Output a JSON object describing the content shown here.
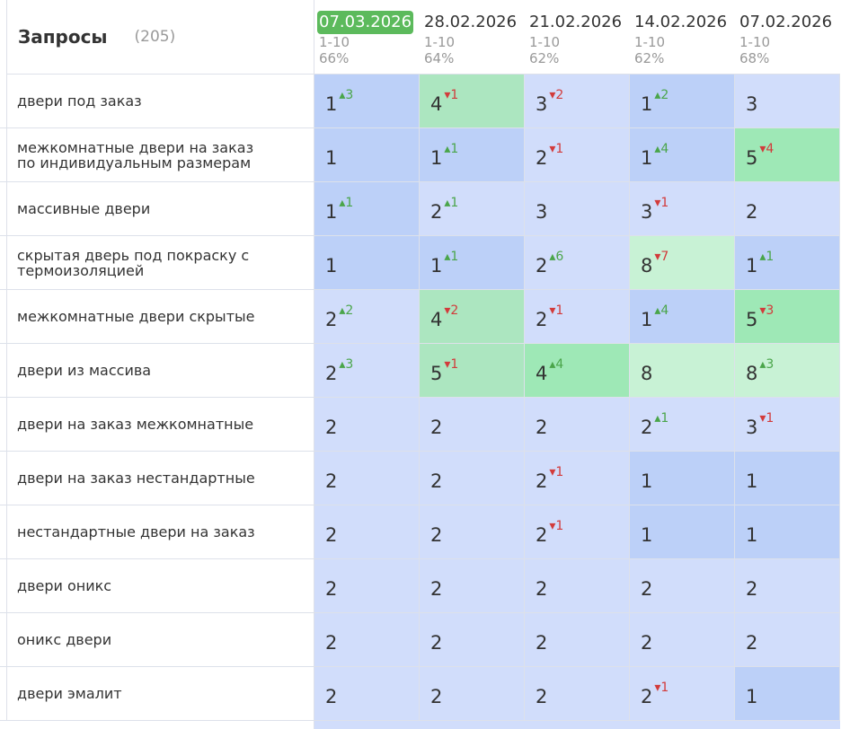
{
  "header": {
    "title": "Запросы",
    "count": "(205)"
  },
  "dates": [
    {
      "date": "07.03.2026",
      "range": "1-10",
      "percent": "66%",
      "active": true
    },
    {
      "date": "28.02.2026",
      "range": "1-10",
      "percent": "64%",
      "active": false
    },
    {
      "date": "21.02.2026",
      "range": "1-10",
      "percent": "62%",
      "active": false
    },
    {
      "date": "14.02.2026",
      "range": "1-10",
      "percent": "62%",
      "active": false
    },
    {
      "date": "07.02.2026",
      "range": "1-10",
      "percent": "68%",
      "active": false
    }
  ],
  "colors": {
    "top1": "#bcd0f8",
    "top3": "#d1ddfb",
    "top10": "#ace6c0",
    "up": "#4aa54a",
    "down": "#d23b3b",
    "active_date": "#5cba5c"
  },
  "rows": [
    {
      "query": "двери под заказ",
      "cells": [
        {
          "pos": "1",
          "chg": "3",
          "dir": "up",
          "bg": "top1"
        },
        {
          "pos": "4",
          "chg": "1",
          "dir": "down",
          "bg": "top10"
        },
        {
          "pos": "3",
          "chg": "2",
          "dir": "down",
          "bg": "top3"
        },
        {
          "pos": "1",
          "chg": "2",
          "dir": "up",
          "bg": "top1"
        },
        {
          "pos": "3",
          "chg": "",
          "dir": "",
          "bg": "top3"
        }
      ]
    },
    {
      "query": "межкомнатные двери на заказ по индивидуальным размерам",
      "cells": [
        {
          "pos": "1",
          "chg": "",
          "dir": "",
          "bg": "top1"
        },
        {
          "pos": "1",
          "chg": "1",
          "dir": "up",
          "bg": "top1"
        },
        {
          "pos": "2",
          "chg": "1",
          "dir": "down",
          "bg": "top3"
        },
        {
          "pos": "1",
          "chg": "4",
          "dir": "up",
          "bg": "top1"
        },
        {
          "pos": "5",
          "chg": "4",
          "dir": "down",
          "bg": "top10c"
        }
      ]
    },
    {
      "query": "массивные двери",
      "cells": [
        {
          "pos": "1",
          "chg": "1",
          "dir": "up",
          "bg": "top1"
        },
        {
          "pos": "2",
          "chg": "1",
          "dir": "up",
          "bg": "top3"
        },
        {
          "pos": "3",
          "chg": "",
          "dir": "",
          "bg": "top3"
        },
        {
          "pos": "3",
          "chg": "1",
          "dir": "down",
          "bg": "top3"
        },
        {
          "pos": "2",
          "chg": "",
          "dir": "",
          "bg": "top3"
        }
      ]
    },
    {
      "query": "скрытая дверь под покраску с термоизоляцией",
      "cells": [
        {
          "pos": "1",
          "chg": "",
          "dir": "",
          "bg": "top1"
        },
        {
          "pos": "1",
          "chg": "1",
          "dir": "up",
          "bg": "top1"
        },
        {
          "pos": "2",
          "chg": "6",
          "dir": "up",
          "bg": "top3"
        },
        {
          "pos": "8",
          "chg": "7",
          "dir": "down",
          "bg": "top10b"
        },
        {
          "pos": "1",
          "chg": "1",
          "dir": "up",
          "bg": "top1"
        }
      ]
    },
    {
      "query": "межкомнатные двери скрытые",
      "cells": [
        {
          "pos": "2",
          "chg": "2",
          "dir": "up",
          "bg": "top3"
        },
        {
          "pos": "4",
          "chg": "2",
          "dir": "down",
          "bg": "top10"
        },
        {
          "pos": "2",
          "chg": "1",
          "dir": "down",
          "bg": "top3"
        },
        {
          "pos": "1",
          "chg": "4",
          "dir": "up",
          "bg": "top1"
        },
        {
          "pos": "5",
          "chg": "3",
          "dir": "down",
          "bg": "top10c"
        }
      ]
    },
    {
      "query": "двери из массива",
      "cells": [
        {
          "pos": "2",
          "chg": "3",
          "dir": "up",
          "bg": "top3"
        },
        {
          "pos": "5",
          "chg": "1",
          "dir": "down",
          "bg": "top10"
        },
        {
          "pos": "4",
          "chg": "4",
          "dir": "up",
          "bg": "top10c"
        },
        {
          "pos": "8",
          "chg": "",
          "dir": "",
          "bg": "top10b"
        },
        {
          "pos": "8",
          "chg": "3",
          "dir": "up",
          "bg": "top10b"
        }
      ]
    },
    {
      "query": "двери на заказ межкомнатные",
      "cells": [
        {
          "pos": "2",
          "chg": "",
          "dir": "",
          "bg": "top3"
        },
        {
          "pos": "2",
          "chg": "",
          "dir": "",
          "bg": "top3"
        },
        {
          "pos": "2",
          "chg": "",
          "dir": "",
          "bg": "top3"
        },
        {
          "pos": "2",
          "chg": "1",
          "dir": "up",
          "bg": "top3"
        },
        {
          "pos": "3",
          "chg": "1",
          "dir": "down",
          "bg": "top3"
        }
      ]
    },
    {
      "query": "двери на заказ нестандартные",
      "cells": [
        {
          "pos": "2",
          "chg": "",
          "dir": "",
          "bg": "top3"
        },
        {
          "pos": "2",
          "chg": "",
          "dir": "",
          "bg": "top3"
        },
        {
          "pos": "2",
          "chg": "1",
          "dir": "down",
          "bg": "top3"
        },
        {
          "pos": "1",
          "chg": "",
          "dir": "",
          "bg": "top1"
        },
        {
          "pos": "1",
          "chg": "",
          "dir": "",
          "bg": "top1"
        }
      ]
    },
    {
      "query": "нестандартные двери на заказ",
      "cells": [
        {
          "pos": "2",
          "chg": "",
          "dir": "",
          "bg": "top3"
        },
        {
          "pos": "2",
          "chg": "",
          "dir": "",
          "bg": "top3"
        },
        {
          "pos": "2",
          "chg": "1",
          "dir": "down",
          "bg": "top3"
        },
        {
          "pos": "1",
          "chg": "",
          "dir": "",
          "bg": "top1"
        },
        {
          "pos": "1",
          "chg": "",
          "dir": "",
          "bg": "top1"
        }
      ]
    },
    {
      "query": "двери оникс",
      "cells": [
        {
          "pos": "2",
          "chg": "",
          "dir": "",
          "bg": "top3"
        },
        {
          "pos": "2",
          "chg": "",
          "dir": "",
          "bg": "top3"
        },
        {
          "pos": "2",
          "chg": "",
          "dir": "",
          "bg": "top3"
        },
        {
          "pos": "2",
          "chg": "",
          "dir": "",
          "bg": "top3"
        },
        {
          "pos": "2",
          "chg": "",
          "dir": "",
          "bg": "top3"
        }
      ]
    },
    {
      "query": "оникс двери",
      "cells": [
        {
          "pos": "2",
          "chg": "",
          "dir": "",
          "bg": "top3"
        },
        {
          "pos": "2",
          "chg": "",
          "dir": "",
          "bg": "top3"
        },
        {
          "pos": "2",
          "chg": "",
          "dir": "",
          "bg": "top3"
        },
        {
          "pos": "2",
          "chg": "",
          "dir": "",
          "bg": "top3"
        },
        {
          "pos": "2",
          "chg": "",
          "dir": "",
          "bg": "top3"
        }
      ]
    },
    {
      "query": "двери эмалит",
      "cells": [
        {
          "pos": "2",
          "chg": "",
          "dir": "",
          "bg": "top3"
        },
        {
          "pos": "2",
          "chg": "",
          "dir": "",
          "bg": "top3"
        },
        {
          "pos": "2",
          "chg": "",
          "dir": "",
          "bg": "top3"
        },
        {
          "pos": "2",
          "chg": "1",
          "dir": "down",
          "bg": "top3"
        },
        {
          "pos": "1",
          "chg": "",
          "dir": "",
          "bg": "top1"
        }
      ]
    }
  ]
}
